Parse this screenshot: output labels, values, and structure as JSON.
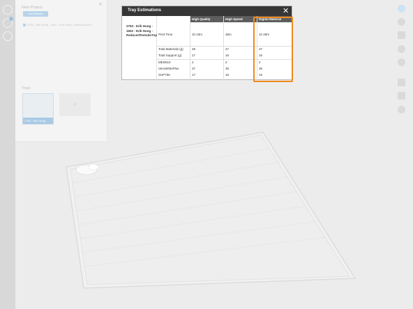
{
  "project_panel": {
    "title": "New Project",
    "add_models_label": "Add Models",
    "file_name": "2753 - Erik Hung - 1602 - Erik Hung - ReducedTestu",
    "trays_label": "Trays",
    "tray_label": "2753 - Erik Hung",
    "add_tray_label": "+"
  },
  "dialog": {
    "title": "Tray Estimations",
    "close_glyph": "✕",
    "tray_name": "2753 - Erik Hung - 1602 - Erik Hung - ReducedTestudoTop",
    "columns": [
      "High Quality",
      "High Speed",
      "Digital Material"
    ],
    "rows": [
      {
        "label": "Print Time",
        "values": [
          "1h 23m",
          "49m",
          "1h 29m"
        ]
      },
      {
        "label": "Total Materials (g)",
        "values": [
          "39",
          "27",
          "37"
        ]
      },
      {
        "label": "Total Support (g)",
        "values": [
          "17",
          "16",
          "16"
        ]
      },
      {
        "label": "MED610",
        "values": [
          "2",
          "2",
          "2"
        ]
      },
      {
        "label": "VeroWhitePlus",
        "values": [
          "37",
          "35",
          "35"
        ]
      },
      {
        "label": "SUP706",
        "values": [
          "17",
          "16",
          "16"
        ]
      }
    ],
    "highlighted_column": "Digital Material"
  },
  "colors": {
    "highlight": "#f08a1e",
    "dialog_header": "#363636",
    "column_header": "#5d5d5d",
    "accent": "#b7d3ea"
  },
  "icons": {
    "left_rail": [
      "add-icon",
      "clock-icon",
      "history-icon"
    ],
    "right_toolbar": [
      "user-icon",
      "add-model-icon",
      "settings-icon",
      "material-icon",
      "printer-icon",
      "arrange-icon",
      "scale-icon",
      "estimate-icon"
    ]
  }
}
